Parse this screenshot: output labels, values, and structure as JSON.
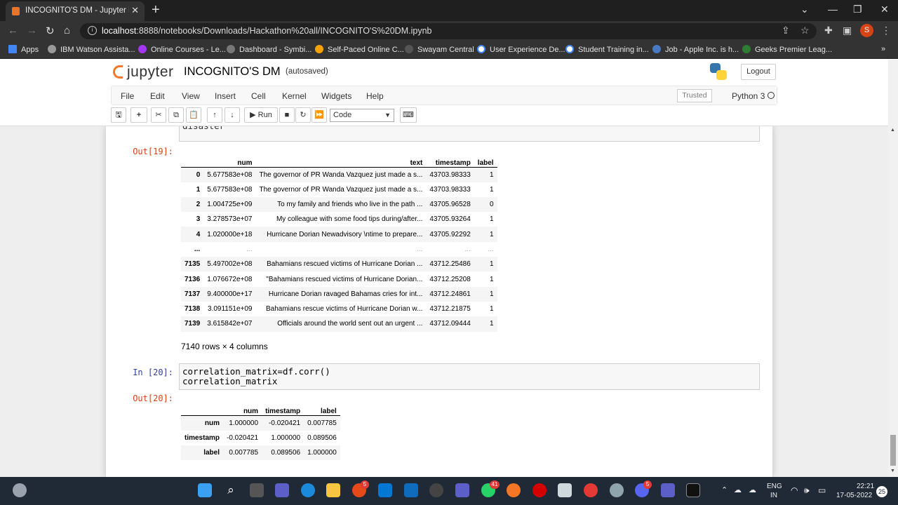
{
  "browser": {
    "tab_title": "INCOGNITO'S DM - Jupyter Note",
    "url_host": "localhost",
    "url_path": ":8888/notebooks/Downloads/Hackathon%20all/INCOGNITO'S%20DM.ipynb",
    "profile_initial": "S",
    "bookmarks": [
      "Apps",
      "IBM Watson Assista...",
      "Online Courses - Le...",
      "Dashboard - Symbi...",
      "Self-Paced Online C...",
      "Swayam Central",
      "User Experience De...",
      "Student Training in...",
      "Job - Apple Inc. is h...",
      "Geeks Premier Leag..."
    ]
  },
  "jupyter": {
    "logo_text": "jupyter",
    "notebook_title": "INCOGNITO'S DM",
    "autosave": "(autosaved)",
    "logout": "Logout",
    "menu": [
      "File",
      "Edit",
      "View",
      "Insert",
      "Cell",
      "Kernel",
      "Widgets",
      "Help"
    ],
    "trusted": "Trusted",
    "kernel": "Python 3",
    "run_label": "Run",
    "cell_type": "Code"
  },
  "notebook": {
    "prev_fragment": "disaster",
    "out19_prompt": "Out[19]:",
    "df": {
      "columns": [
        "num",
        "text",
        "timestamp",
        "label"
      ],
      "rows": [
        [
          "0",
          "5.677583e+08",
          "The governor of PR Wanda Vazquez just made a s...",
          "43703.98333",
          "1"
        ],
        [
          "1",
          "5.677583e+08",
          "The governor of PR Wanda Vazquez just made a s...",
          "43703.98333",
          "1"
        ],
        [
          "2",
          "1.004725e+09",
          "To my family and friends who live in the path ...",
          "43705.96528",
          "0"
        ],
        [
          "3",
          "3.278573e+07",
          "My colleague with some food tips during/after...",
          "43705.93264",
          "1"
        ],
        [
          "4",
          "1.020000e+18",
          "Hurricane Dorian Newadvisory \\ntime to prepare...",
          "43705.92292",
          "1"
        ],
        [
          "...",
          "...",
          "...",
          "...",
          "..."
        ],
        [
          "7135",
          "5.497002e+08",
          "Bahamians rescued victims of Hurricane Dorian ...",
          "43712.25486",
          "1"
        ],
        [
          "7136",
          "1.076672e+08",
          "\"Bahamians rescued victims of Hurricane Dorian...",
          "43712.25208",
          "1"
        ],
        [
          "7137",
          "9.400000e+17",
          "Hurricane Dorian ravaged Bahamas cries for int...",
          "43712.24861",
          "1"
        ],
        [
          "7138",
          "3.091151e+09",
          "Bahamians rescue victims of Hurricane Dorian w...",
          "43712.21875",
          "1"
        ],
        [
          "7139",
          "3.615842e+07",
          "Officials around the world sent out an urgent ...",
          "43712.09444",
          "1"
        ]
      ],
      "shape": "7140 rows × 4 columns"
    },
    "in20_prompt": "In [20]:",
    "in20_code": "correlation_matrix=df.corr()\ncorrelation_matrix",
    "out20_prompt": "Out[20]:",
    "corr": {
      "columns": [
        "num",
        "timestamp",
        "label"
      ],
      "rows": [
        [
          "num",
          "1.000000",
          "-0.020421",
          "0.007785"
        ],
        [
          "timestamp",
          "-0.020421",
          "1.000000",
          "0.089506"
        ],
        [
          "label",
          "0.007785",
          "0.089506",
          "1.000000"
        ]
      ]
    }
  },
  "taskbar": {
    "lang": "ENG",
    "region": "IN",
    "time": "22:21",
    "date": "17-05-2022",
    "notif_count": "25",
    "badges": {
      "chrome": "5",
      "whatsapp": "41",
      "discord": "5"
    }
  }
}
